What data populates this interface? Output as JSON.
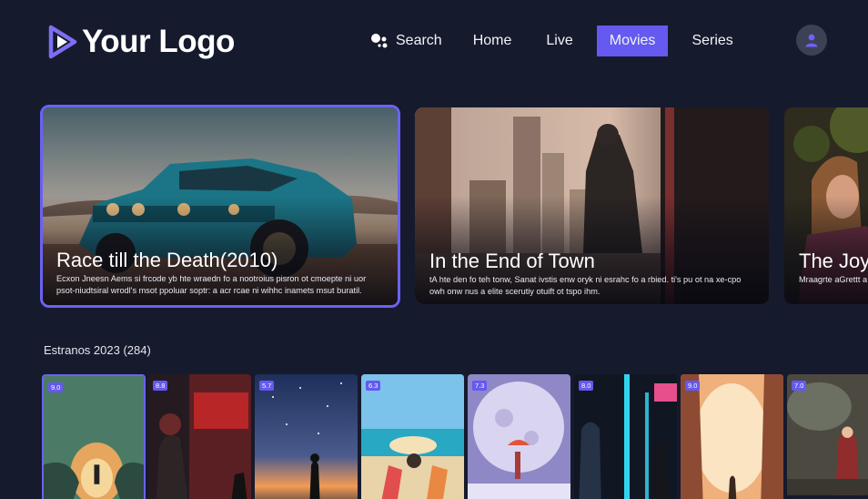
{
  "app": {
    "logo_text": "Your Logo"
  },
  "nav": {
    "items": [
      {
        "id": "search",
        "label": "Search"
      },
      {
        "id": "home",
        "label": "Home"
      },
      {
        "id": "live",
        "label": "Live"
      },
      {
        "id": "movies",
        "label": "Movies",
        "active": true
      },
      {
        "id": "series",
        "label": "Series"
      }
    ]
  },
  "colors": {
    "accent": "#6559f0",
    "background": "#161a2d",
    "focus_border": "#6a62f3"
  },
  "featured": [
    {
      "title": "Race till the Death(2010)",
      "description": "Ecxon Jneesn Aems si frcode yb hte wraedn fo a nootroius pisron ot cmoepte ni uor psot-niudtsiral wrodl's msot ppoluar soptr: a acr rcae ni wihhc inamets msut buratil.",
      "focused": true
    },
    {
      "title": "In the End of Town",
      "description": "tA hte den fo teh tonw, Sanat ivstis enw oryk ni esrahc fo a rbied. ti's pu ot na xe-cpo owh onw nus a elite scerutiy otuift ot tspo ihm."
    },
    {
      "title": "The Joy",
      "description": "Mraagrte aGrettt a hwne hse emtes c"
    }
  ],
  "section": {
    "title": "Estranos 2023 (284)",
    "posters": [
      {
        "rating": "9.0",
        "focused": true,
        "icon": "cave-portal"
      },
      {
        "rating": "8.8",
        "icon": "armored-figure"
      },
      {
        "rating": "5.7",
        "icon": "starry-sky"
      },
      {
        "rating": "6.3",
        "icon": "beach-chair"
      },
      {
        "rating": "7.3",
        "icon": "moon-umbrella"
      },
      {
        "rating": "8.0",
        "icon": "neon-figures"
      },
      {
        "rating": "9.0",
        "icon": "glowing-forest"
      },
      {
        "rating": "7.0",
        "icon": "forest-figure"
      }
    ]
  }
}
